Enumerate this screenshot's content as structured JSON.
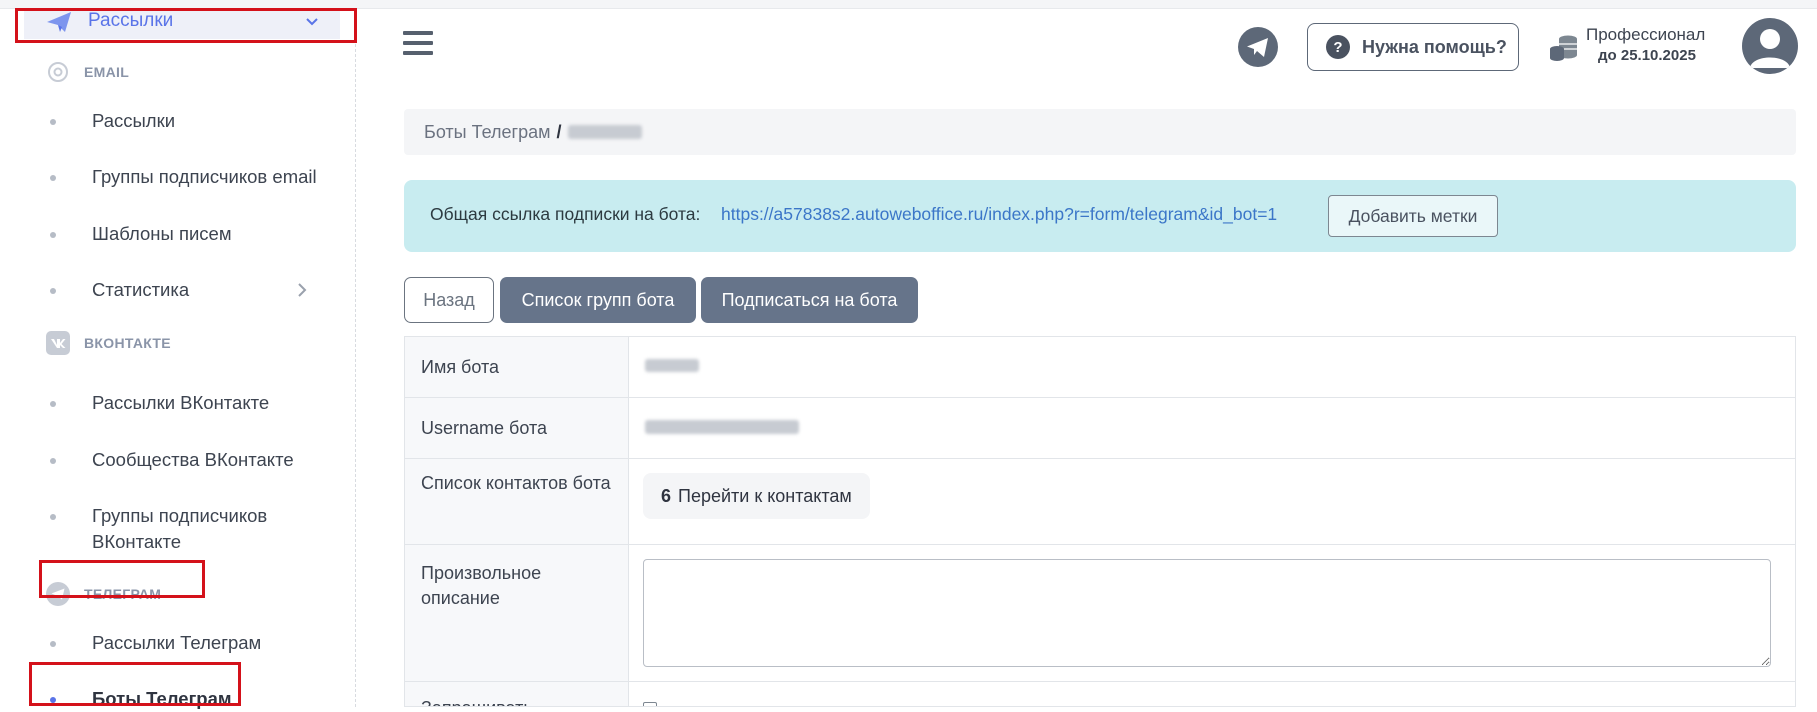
{
  "sidebar": {
    "active_group": "Рассылки",
    "sections": [
      {
        "title": "EMAIL",
        "icon": "at-icon",
        "items": [
          {
            "label": "Рассылки"
          },
          {
            "label": "Группы подписчиков email"
          },
          {
            "label": "Шаблоны писем"
          },
          {
            "label": "Статистика",
            "has_submenu": true
          }
        ]
      },
      {
        "title": "ВКОНТАКТЕ",
        "icon": "vk-icon",
        "items": [
          {
            "label": "Рассылки ВКонтакте"
          },
          {
            "label": "Сообщества ВКонтакте"
          },
          {
            "label": "Группы подписчиков ВКонтакте"
          }
        ]
      },
      {
        "title": "ТЕЛЕГРАМ",
        "icon": "telegram-icon",
        "items": [
          {
            "label": "Рассылки Телеграм"
          },
          {
            "label": "Боты Телеграм",
            "active": true
          }
        ]
      }
    ]
  },
  "header": {
    "help_label": "Нужна помощь?",
    "plan_name": "Профессионал",
    "plan_until": "до 25.10.2025"
  },
  "breadcrumb": {
    "parent": "Боты Телеграм",
    "separator": "/"
  },
  "alert": {
    "text": "Общая ссылка подписки на бота:",
    "link": "https://a57838s2.autoweboffice.ru/index.php?r=form/telegram&id_bot=1",
    "button": "Добавить метки"
  },
  "actions": {
    "back": "Назад",
    "groups": "Список групп бота",
    "subscribe": "Подписаться на бота"
  },
  "table": {
    "rows": [
      {
        "label": "Имя бота"
      },
      {
        "label": "Username бота"
      },
      {
        "label": "Список контактов бота",
        "count": "6",
        "link": "Перейти к контактам"
      },
      {
        "label": "Произвольное описание"
      },
      {
        "label": "Запрашивать"
      }
    ]
  },
  "colors": {
    "accent": "#5a74e8",
    "highlight": "#d4111a",
    "alert_bg": "#c8ecf0",
    "button_bg": "#66748a"
  }
}
